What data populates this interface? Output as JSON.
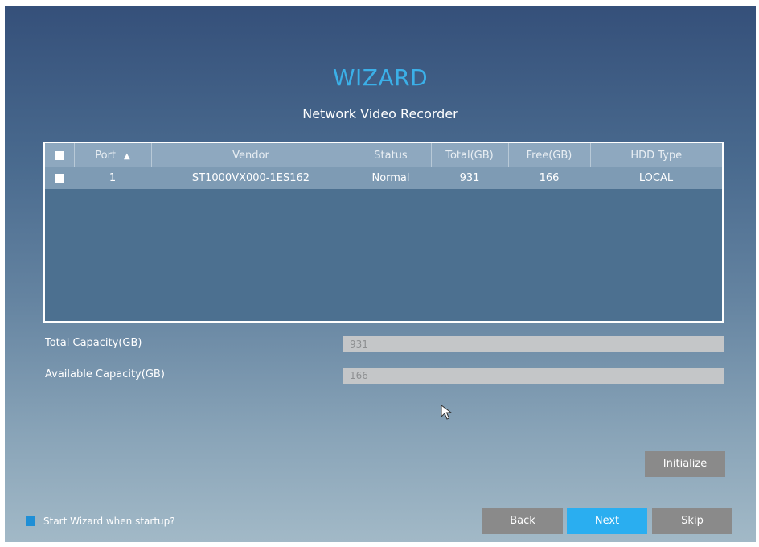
{
  "header": {
    "title": "WIZARD",
    "subtitle": "Network Video Recorder"
  },
  "table": {
    "columns": [
      "Port",
      "Vendor",
      "Status",
      "Total(GB)",
      "Free(GB)",
      "HDD Type"
    ],
    "sort_column": "Port",
    "sort_direction": "ascending",
    "rows": [
      {
        "port": "1",
        "vendor": "ST1000VX000-1ES162",
        "status": "Normal",
        "total": "931",
        "free": "166",
        "hdd_type": "LOCAL"
      }
    ]
  },
  "capacity": {
    "total_label": "Total Capacity(GB)",
    "total_value": "931",
    "available_label": "Available Capacity(GB)",
    "available_value": "166"
  },
  "buttons": {
    "initialize": "Initialize",
    "back": "Back",
    "next": "Next",
    "skip": "Skip"
  },
  "startup": {
    "label": "Start Wizard when startup?",
    "checked": true
  },
  "colors": {
    "accent": "#2aaef0",
    "title": "#3bb0e8",
    "button_grey": "#8a8a8a",
    "checkbox_checked": "#1f8fd6"
  }
}
